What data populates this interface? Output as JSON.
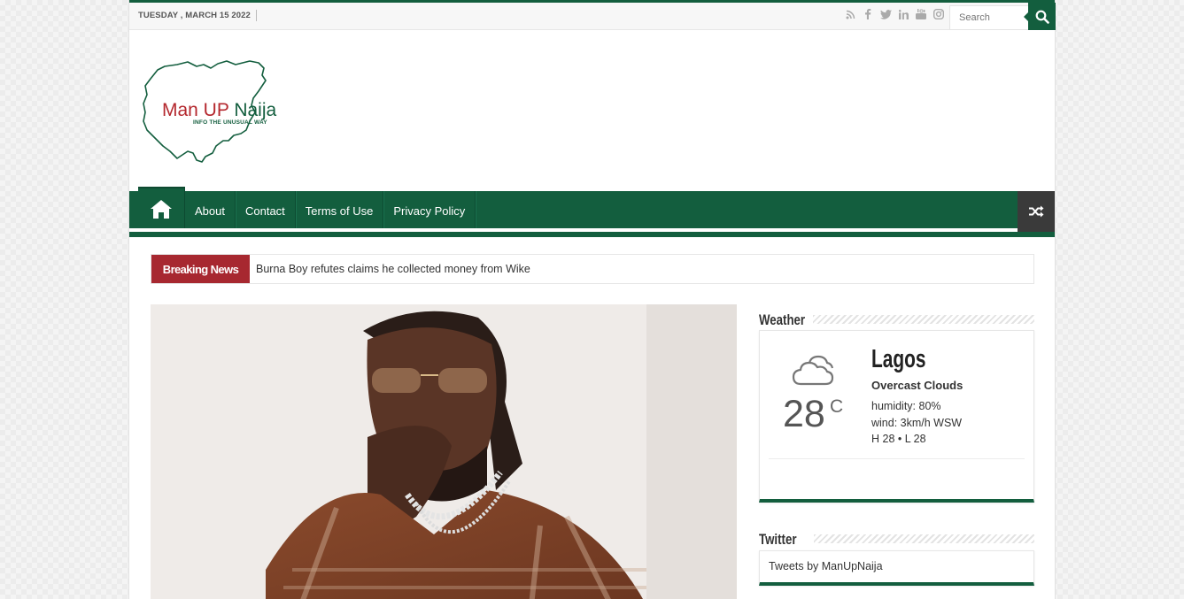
{
  "topbar": {
    "date": "TUESDAY , MARCH 15 2022",
    "social_icons": [
      "rss-icon",
      "facebook-icon",
      "twitter-icon",
      "linkedin-icon",
      "youtube-icon",
      "instagram-icon"
    ],
    "search_placeholder": "Search"
  },
  "logo": {
    "word1": "Man UP",
    "word2": "Naija",
    "tagline": "INFO THE UNUSUAL WAY"
  },
  "nav": {
    "items": [
      {
        "label": "About"
      },
      {
        "label": "Contact"
      },
      {
        "label": "Terms of Use"
      },
      {
        "label": "Privacy Policy"
      }
    ]
  },
  "breaking": {
    "label": "Breaking News",
    "headline": "Burna Boy refutes claims he collected money from Wike"
  },
  "sidebar": {
    "weather": {
      "title": "Weather",
      "city": "Lagos",
      "description": "Overcast Clouds",
      "humidity": "humidity: 80%",
      "wind": "wind: 3km/h WSW",
      "hilo": "H 28 • L 28",
      "temperature": "28",
      "unit": "C"
    },
    "twitter": {
      "title": "Twitter",
      "link": "Tweets by ManUpNaija"
    }
  },
  "colors": {
    "brand_green": "#135e3e",
    "brand_red": "#a72830",
    "dark": "#3a3a3a"
  }
}
